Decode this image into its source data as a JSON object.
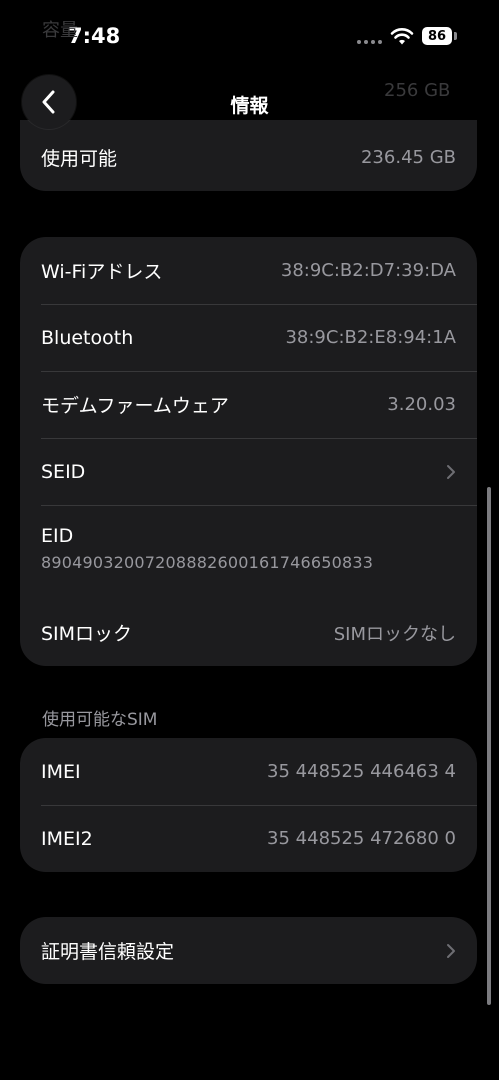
{
  "status_bar": {
    "time": "7:48",
    "battery_level": "86"
  },
  "nav": {
    "title": "情報",
    "ghost_top_label": "容量",
    "ghost_top_value": "256 GB"
  },
  "storage_card": {
    "available_label": "使用可能",
    "available_value": "236.45 GB"
  },
  "network_card": {
    "wifi_label": "Wi-Fiアドレス",
    "wifi_value": "38:9C:B2:D7:39:DA",
    "bluetooth_label": "Bluetooth",
    "bluetooth_value": "38:9C:B2:E8:94:1A",
    "modem_label": "モデムファームウェア",
    "modem_value": "3.20.03",
    "seid_label": "SEID",
    "eid_label": "EID",
    "eid_value": "89049032007208882600161746650833",
    "simlock_label": "SIMロック",
    "simlock_value": "SIMロックなし"
  },
  "sim_section": {
    "header": "使用可能なSIM",
    "imei_label": "IMEI",
    "imei_value": "35 448525 446463 4",
    "imei2_label": "IMEI2",
    "imei2_value": "35 448525 472680 0"
  },
  "cert_card": {
    "label": "証明書信頼設定"
  },
  "colors": {
    "background": "#000000",
    "card": "#1c1c1e",
    "secondary_text": "#98989e",
    "separator": "#38383a"
  }
}
